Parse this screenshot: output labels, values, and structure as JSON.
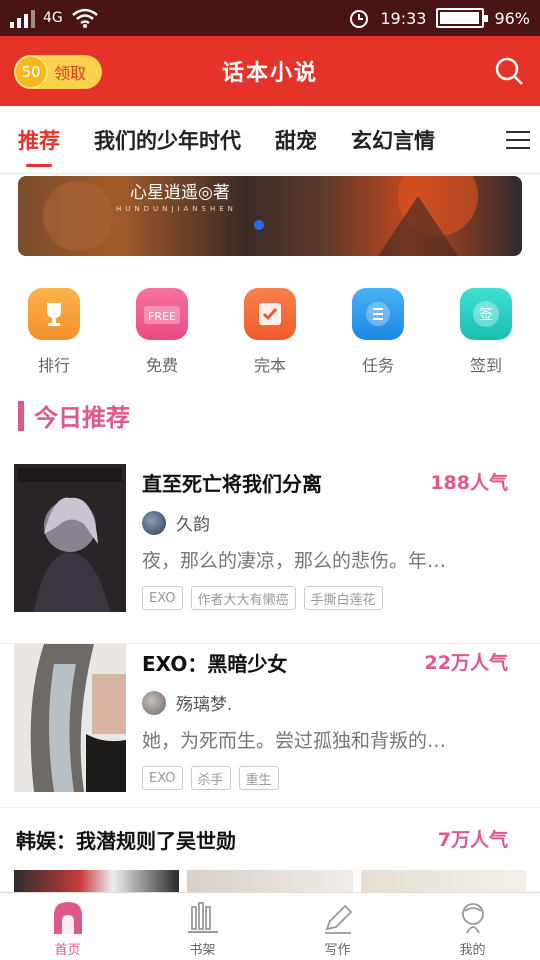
{
  "status_bar": {
    "network": "4G",
    "time": "19:33",
    "battery": "96%",
    "battery_level": 0.96
  },
  "header": {
    "coin_count": "50",
    "coin_label": "领取",
    "title": "话本小说"
  },
  "tabs": [
    {
      "label": "推荐",
      "active": true
    },
    {
      "label": "我们的少年时代",
      "active": false
    },
    {
      "label": "甜宠",
      "active": false
    },
    {
      "label": "玄幻言情",
      "active": false
    }
  ],
  "banner": {
    "title": "心星逍遥◎著",
    "subtitle": "HUNDUNJIANSHEN"
  },
  "quick_links": [
    {
      "label": "排行",
      "icon": "trophy-icon",
      "color": "#f7a23b"
    },
    {
      "label": "免费",
      "icon": "free-icon",
      "color": "#f0588f"
    },
    {
      "label": "完本",
      "icon": "check-icon",
      "color": "#f26a3b"
    },
    {
      "label": "任务",
      "icon": "list-icon",
      "color": "#2e9ef0"
    },
    {
      "label": "签到",
      "icon": "signin-icon",
      "color": "#23d1c4"
    }
  ],
  "section": {
    "title": "今日推荐"
  },
  "books": [
    {
      "title": "直至死亡将我们分离",
      "popularity": "188人气",
      "author": "久韵",
      "desc": "夜，那么的凄凉，那么的悲伤。年…",
      "tags": [
        "EXO",
        "作者大大有懒癌",
        "手撕白莲花"
      ]
    },
    {
      "title": "EXO：黑暗少女",
      "popularity": "22万人气",
      "author": "殇璃梦.",
      "desc": "她，为死而生。尝过孤独和背叛的…",
      "tags": [
        "EXO",
        "杀手",
        "重生"
      ]
    }
  ],
  "row3": {
    "title": "韩娱：我潜规则了吴世勋",
    "popularity": "7万人气"
  },
  "bottom_nav": [
    {
      "label": "首页",
      "icon": "home-icon",
      "active": true
    },
    {
      "label": "书架",
      "icon": "bookshelf-icon",
      "active": false
    },
    {
      "label": "写作",
      "icon": "pen-icon",
      "active": false
    },
    {
      "label": "我的",
      "icon": "profile-icon",
      "active": false
    }
  ],
  "colors": {
    "brand_red": "#e5332a",
    "accent_pink": "#e0578b"
  }
}
